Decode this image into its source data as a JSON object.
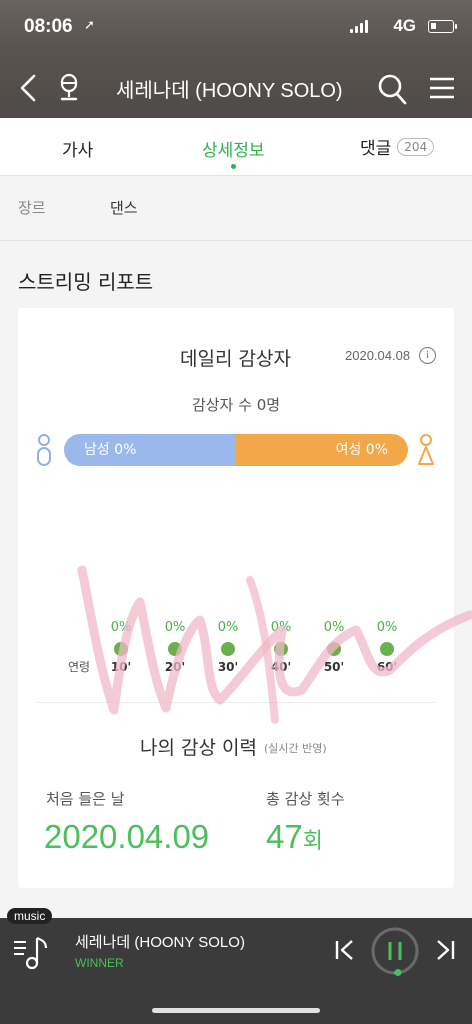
{
  "status": {
    "time": "08:06",
    "network": "4G"
  },
  "header": {
    "title": "세레나데 (HOONY SOLO)"
  },
  "tabs": {
    "lyrics": "가사",
    "detail": "상세정보",
    "comments": "댓글",
    "comments_count": "204"
  },
  "genre": {
    "label": "장르",
    "value": "댄스"
  },
  "report": {
    "title": "스트리밍 리포트",
    "daily": {
      "title": "데일리 감상자",
      "date": "2020.04.08",
      "listeners": "감상자 수 0명"
    },
    "gender": {
      "male": "남성 0%",
      "female": "여성 0%",
      "male_share": 0.5,
      "male_color": "#9bb8ec",
      "female_color": "#f2a749"
    },
    "age": {
      "label": "연령",
      "groups": [
        {
          "pct": "0%",
          "age": "10'"
        },
        {
          "pct": "0%",
          "age": "20'"
        },
        {
          "pct": "0%",
          "age": "30'"
        },
        {
          "pct": "0%",
          "age": "40'"
        },
        {
          "pct": "0%",
          "age": "50'"
        },
        {
          "pct": "0%",
          "age": "60'"
        }
      ]
    },
    "history": {
      "title": "나의 감상 이력",
      "subtitle": "(실시간 반영)",
      "first_label": "처음 들은 날",
      "first_value": "2020.04.09",
      "total_label": "총 감상 횟수",
      "total_value": "47",
      "total_unit": "회"
    }
  },
  "player": {
    "tag": "music",
    "title": "세레나데 (HOONY SOLO)",
    "artist": "WINNER",
    "accent": "#4cbf5a"
  },
  "icons": [
    "back-icon",
    "microphone-icon",
    "search-icon",
    "menu-icon",
    "info-icon",
    "male-icon",
    "female-icon",
    "queue-icon",
    "previous-icon",
    "pause-icon",
    "next-icon"
  ]
}
